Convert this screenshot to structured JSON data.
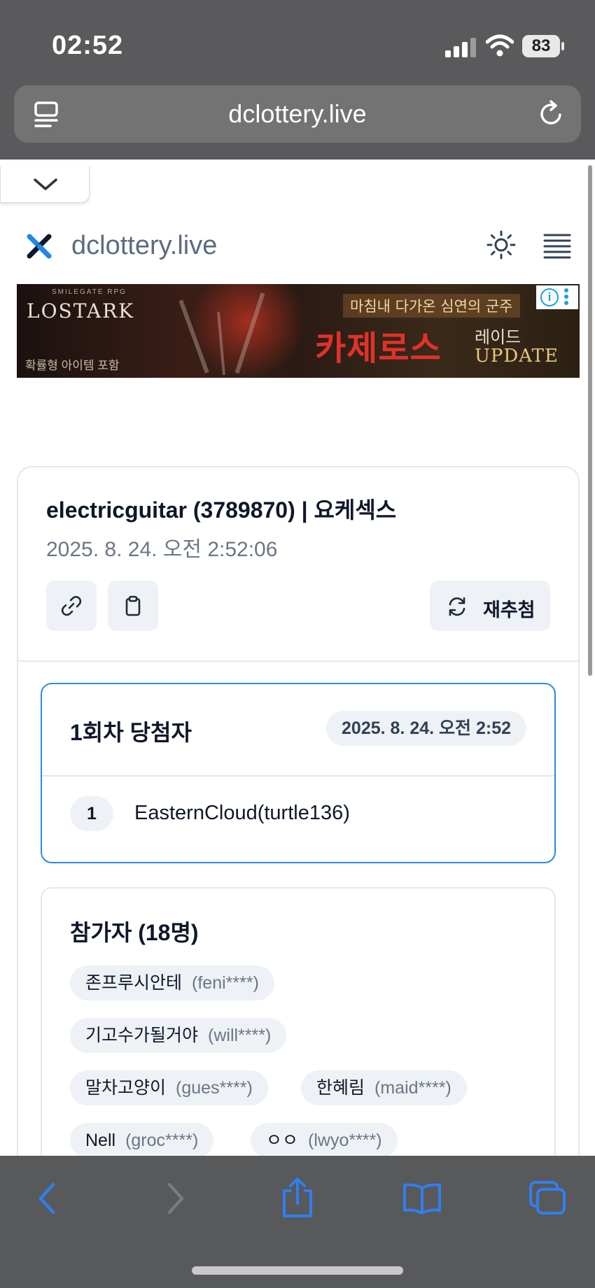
{
  "status_bar": {
    "time": "02:52",
    "battery": "83"
  },
  "browser": {
    "url": "dclottery.live"
  },
  "site": {
    "title": "dclottery.live"
  },
  "ad": {
    "logo": "LOSTARK",
    "small_top": "SMILEGATE RPG",
    "subtext": "확률형 아이템 포함",
    "tagline": "마침내 다가온 심연의 군주",
    "headline": "카제로스",
    "raid": "레이드",
    "update": "UPDATE",
    "info_label": "i"
  },
  "event": {
    "title": "electricguitar (3789870) | 요케섹스",
    "date": "2025. 8. 24. 오전 2:52:06",
    "redraw_label": "재추첨"
  },
  "winner": {
    "title": "1회차 당첨자",
    "date": "2025. 8. 24. 오전 2:52",
    "rank": "1",
    "name": "EasternCloud(turtle136)"
  },
  "participants": {
    "title": "참가자 (18명)",
    "items": [
      {
        "name": "존프루시안테",
        "id": "(feni****)"
      },
      {
        "name": "기고수가될거야",
        "id": "(will****)"
      },
      {
        "name": "말차고양이",
        "id": "(gues****)"
      },
      {
        "name": "한혜림",
        "id": "(maid****)"
      },
      {
        "name": "Nell",
        "id": "(groc****)"
      },
      {
        "name": "ㅇㅇ",
        "id": "(lwyo****)"
      }
    ]
  },
  "colors": {
    "accent": "#2b8be0",
    "chip_bg": "#eef2f6",
    "logo_blue": "#1e88e5"
  }
}
